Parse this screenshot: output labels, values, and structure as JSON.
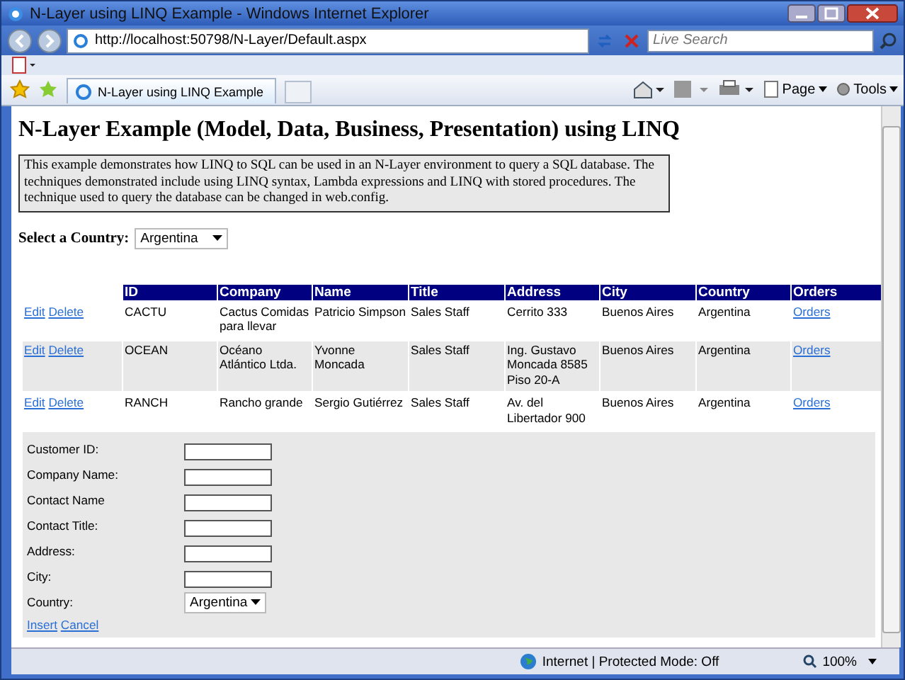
{
  "window": {
    "title": "N-Layer using LINQ Example - Windows Internet Explorer"
  },
  "address_bar": {
    "url": "http://localhost:50798/N-Layer/Default.aspx"
  },
  "search": {
    "placeholder": "Live Search"
  },
  "tab": {
    "title": "N-Layer using LINQ Example"
  },
  "command_bar": {
    "buttons": [
      "Page",
      "Tools"
    ]
  },
  "page": {
    "heading": "N-Layer Example (Model, Data, Business, Presentation) using LINQ",
    "description": "This example demonstrates how LINQ to SQL can be used in an N-Layer environment to query a SQL database. The techniques demonstrated include using LINQ syntax, Lambda expressions and LINQ with stored procedures. The technique used to query the database can be changed in web.config.",
    "country_filter": {
      "label": "Select a Country:",
      "value": "Argentina"
    }
  },
  "table": {
    "columns": [
      "ID",
      "Company",
      "Name",
      "Title",
      "Address",
      "City",
      "Country",
      "Orders"
    ],
    "rows": [
      {
        "actions": [
          "Edit",
          "Delete"
        ],
        "cells": [
          "CACTU",
          "Cactus Comidas para llevar",
          "Patricio Simpson",
          "Sales Staff",
          "Cerrito 333",
          "Buenos Aires",
          "Argentina"
        ],
        "link": "Orders"
      },
      {
        "actions": [
          "Edit",
          "Delete"
        ],
        "cells": [
          "OCEAN",
          "Océano Atlántico Ltda.",
          "Yvonne Moncada",
          "Sales Staff",
          "Ing. Gustavo Moncada 8585 Piso 20-A",
          "Buenos Aires",
          "Argentina"
        ],
        "link": "Orders"
      },
      {
        "actions": [
          "Edit",
          "Delete"
        ],
        "cells": [
          "RANCH",
          "Rancho grande",
          "Sergio Gutiérrez",
          "Sales Staff",
          "Av. del Libertador 900",
          "Buenos Aires",
          "Argentina"
        ],
        "link": "Orders"
      }
    ]
  },
  "insert_form": {
    "fields": [
      {
        "label": "Customer ID:"
      },
      {
        "label": "Company Name:"
      },
      {
        "label": "Contact Name"
      },
      {
        "label": "Contact Title:"
      },
      {
        "label": "Address:"
      },
      {
        "label": "City:"
      }
    ],
    "country": {
      "label": "Country:",
      "value": "Argentina"
    },
    "actions": [
      "Insert",
      "Cancel"
    ]
  },
  "status_bar": {
    "zone": "Internet | Protected Mode: Off",
    "zoom": "100%"
  }
}
